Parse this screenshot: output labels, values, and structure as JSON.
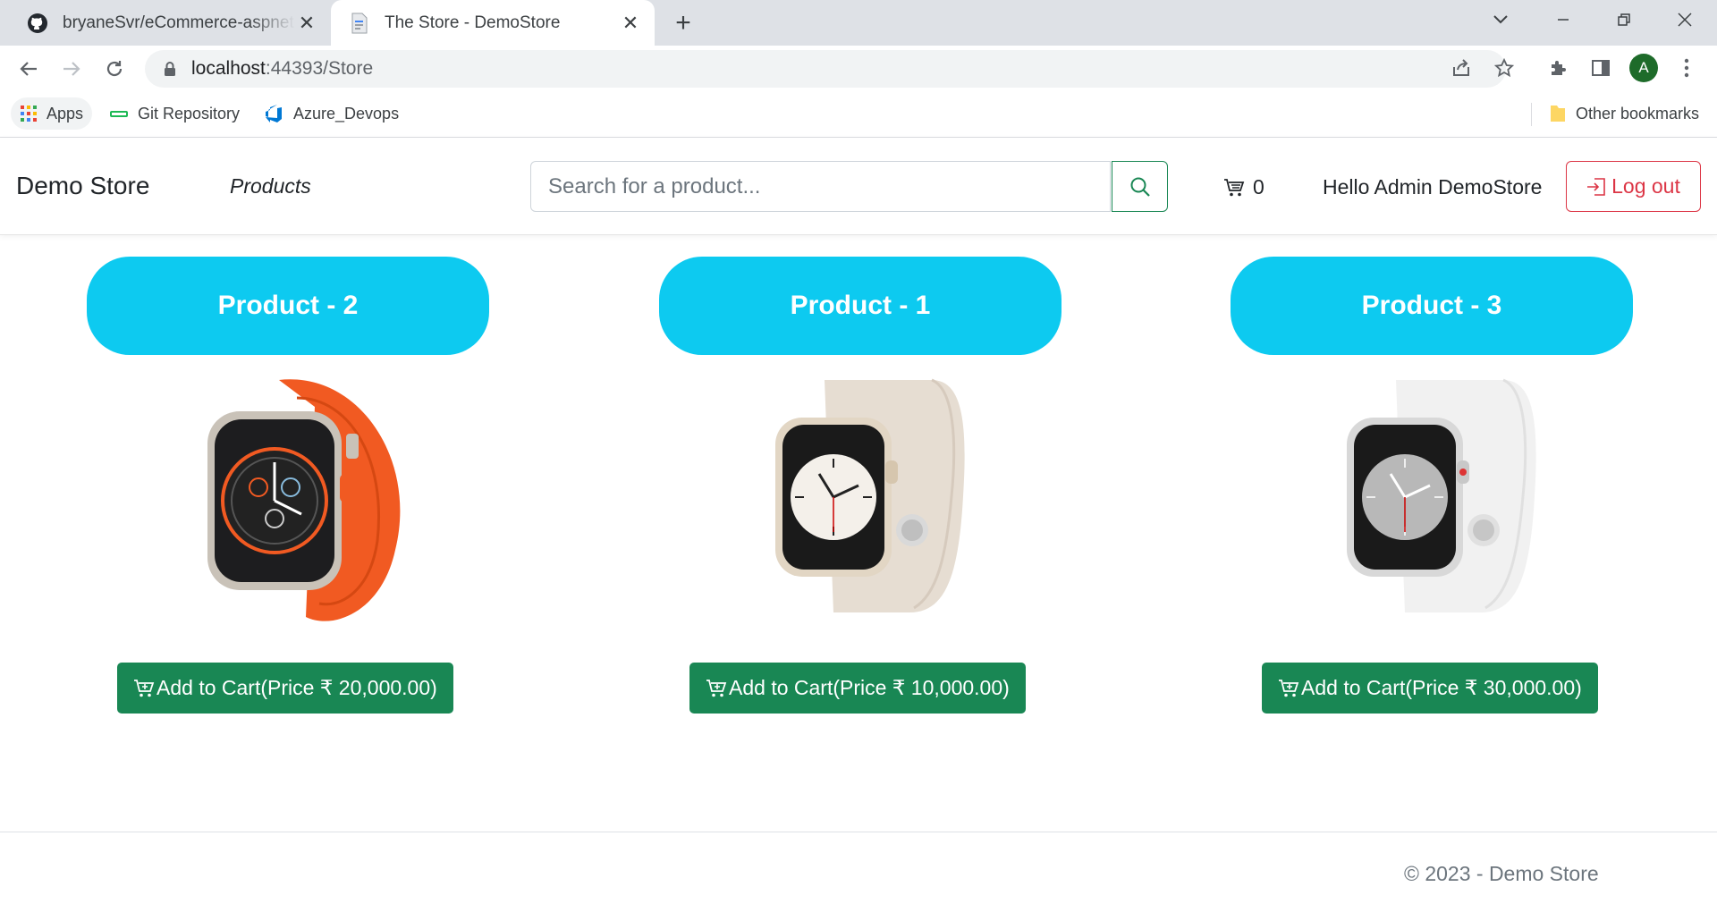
{
  "browser": {
    "tabs": [
      {
        "title": "bryaneSvr/eCommerce-aspnet-mvc-app",
        "favicon": "github-icon",
        "active": false
      },
      {
        "title": "The Store - DemoStore",
        "favicon": "document-icon",
        "active": true
      }
    ],
    "url": {
      "host": "localhost",
      "path": ":44393/Store"
    },
    "bookmarks": [
      {
        "label": "Apps",
        "icon": "apps-grid-icon"
      },
      {
        "label": "Git Repository",
        "icon": "git-icon"
      },
      {
        "label": "Azure_Devops",
        "icon": "azure-devops-icon"
      }
    ],
    "other_bookmarks": "Other bookmarks",
    "profile_initial": "A"
  },
  "store": {
    "brand": "Demo Store",
    "nav_products": "Products",
    "search_placeholder": "Search for a product...",
    "cart_count": "0",
    "greeting": "Hello Admin DemoStore",
    "logout": "Log out",
    "accent_colors": {
      "info": "#0dcaf0",
      "success": "#198754",
      "danger": "#dc3545"
    },
    "products": [
      {
        "name": "Product - 2",
        "cart_label": "Add to Cart(Price ₹ 20,000.00)",
        "image": "orange-band-watch"
      },
      {
        "name": "Product - 1",
        "cart_label": "Add to Cart(Price ₹ 10,000.00)",
        "image": "starlight-band-watch"
      },
      {
        "name": "Product - 3",
        "cart_label": "Add to Cart(Price ₹ 30,000.00)",
        "image": "white-band-watch"
      }
    ],
    "footer": "© 2023 - Demo Store"
  }
}
